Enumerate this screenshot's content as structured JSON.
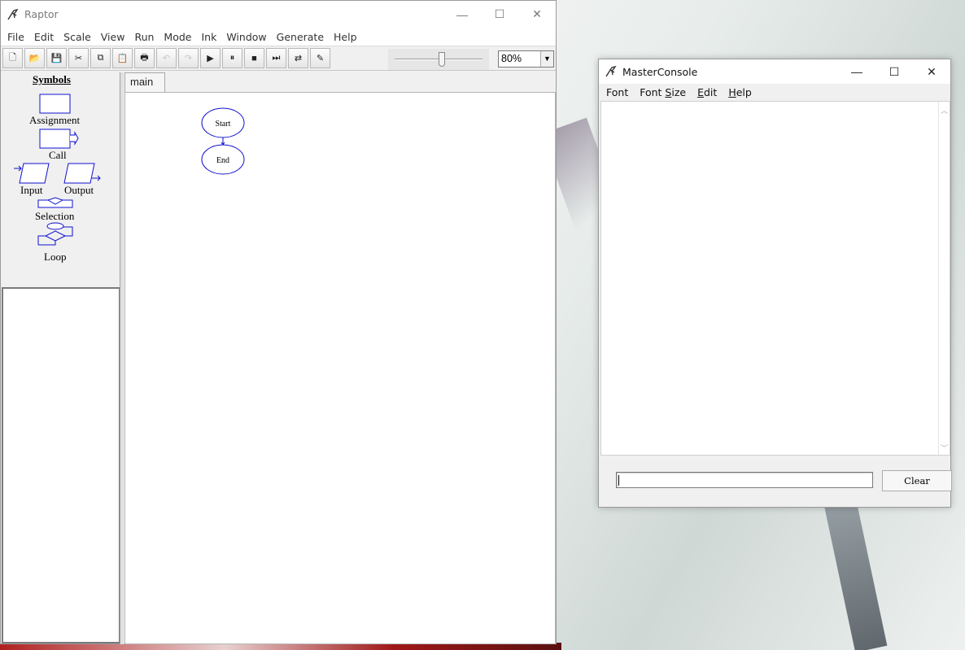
{
  "raptor": {
    "title": "Raptor",
    "window_controls": {
      "minimize": "—",
      "maximize": "☐",
      "close": "✕"
    },
    "menu": [
      "File",
      "Edit",
      "Scale",
      "View",
      "Run",
      "Mode",
      "Ink",
      "Window",
      "Generate",
      "Help"
    ],
    "toolbar": {
      "buttons": [
        {
          "name": "new-icon",
          "glyph": "🗋"
        },
        {
          "name": "open-icon",
          "glyph": "📂"
        },
        {
          "name": "save-icon",
          "glyph": "💾"
        },
        {
          "name": "cut-icon",
          "glyph": "✂"
        },
        {
          "name": "copy-icon",
          "glyph": "⧉"
        },
        {
          "name": "paste-icon",
          "glyph": "📋"
        },
        {
          "name": "print-icon",
          "glyph": "🖶"
        },
        {
          "name": "undo-icon",
          "glyph": "↶",
          "disabled": true
        },
        {
          "name": "redo-icon",
          "glyph": "↷",
          "disabled": true
        },
        {
          "name": "run-icon",
          "glyph": "▶"
        },
        {
          "name": "pause-icon",
          "glyph": "⏸"
        },
        {
          "name": "stop-icon",
          "glyph": "■"
        },
        {
          "name": "step-icon",
          "glyph": "⏭"
        },
        {
          "name": "test-server-icon",
          "glyph": "⇄"
        },
        {
          "name": "ink-pen-icon",
          "glyph": "✎"
        }
      ],
      "zoom_value": "80%"
    },
    "symbols": {
      "title": "Symbols",
      "assignment": "Assignment",
      "call": "Call",
      "input": "Input",
      "output": "Output",
      "selection": "Selection",
      "loop": "Loop"
    },
    "tab": "main",
    "flowchart": {
      "start": "Start",
      "end": "End"
    }
  },
  "console": {
    "title": "MasterConsole",
    "window_controls": {
      "minimize": "—",
      "maximize": "☐",
      "close": "✕"
    },
    "menu": {
      "font": "Font",
      "font_size_pre": "Font ",
      "font_size_u": "S",
      "font_size_post": "ize",
      "edit_u": "E",
      "edit_post": "dit",
      "help_u": "H",
      "help_post": "elp"
    },
    "output_text": "",
    "input_value": "",
    "clear_label": "Clear"
  },
  "colors": {
    "flowchart_blue": "#1010d0"
  }
}
